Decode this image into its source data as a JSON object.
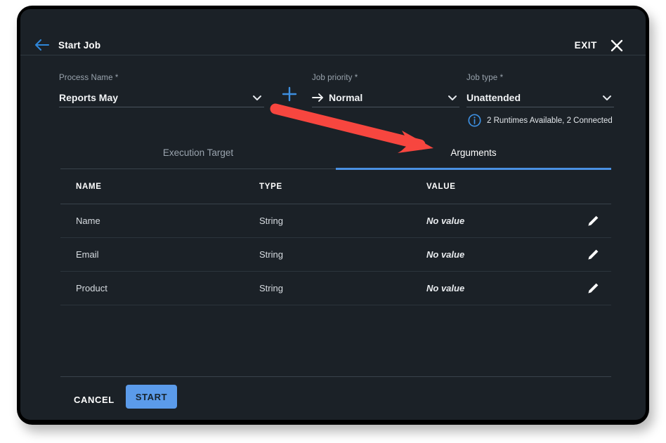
{
  "window": {
    "header": {
      "back_icon": "arrow-left-icon",
      "title": "Start Job",
      "exit_label": "EXIT",
      "close_icon": "close-icon"
    }
  },
  "form": {
    "process": {
      "label": "Process Name *",
      "value": "Reports May",
      "chevron_icon": "chevron-down-icon",
      "add_icon": "plus-icon"
    },
    "priority": {
      "label": "Job priority *",
      "value": "Normal",
      "prefix_icon": "arrow-right-icon",
      "chevron_icon": "chevron-down-icon"
    },
    "jobtype": {
      "label": "Job type *",
      "value": "Unattended",
      "chevron_icon": "chevron-down-icon"
    },
    "runtimes": {
      "info_icon": "info-circle-icon",
      "text": "2 Runtimes Available, 2 Connected"
    }
  },
  "tabs": [
    {
      "label": "Execution Target",
      "active": false
    },
    {
      "label": "Arguments",
      "active": true
    }
  ],
  "table": {
    "headers": [
      "NAME",
      "TYPE",
      "VALUE"
    ],
    "edit_icon": "pencil-icon",
    "rows": [
      {
        "name": "Name",
        "type": "String",
        "value": "No value"
      },
      {
        "name": "Email",
        "type": "String",
        "value": "No value"
      },
      {
        "name": "Product",
        "type": "String",
        "value": "No value"
      }
    ]
  },
  "footer": {
    "cancel_label": "CANCEL",
    "start_label": "START"
  },
  "annotation": {
    "arrow_color": "#f7463f",
    "points_to": "Arguments"
  },
  "colors": {
    "panel_bg": "#1b2127",
    "accent_blue": "#4a90e2",
    "start_button": "#5b9bea",
    "annotation_red": "#f7463f"
  }
}
